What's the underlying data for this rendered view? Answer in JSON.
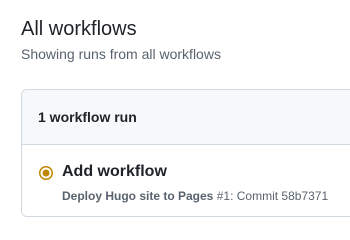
{
  "header": {
    "title": "All workflows",
    "subtitle": "Showing runs from all workflows"
  },
  "runs": {
    "count_label": "1 workflow run",
    "items": [
      {
        "title": "Add workflow",
        "status": "in-progress",
        "status_icon": "in-progress-dot-icon",
        "status_color": "#bf8700",
        "workflow_name": "Deploy Hugo site to Pages",
        "run_number": "#1",
        "event_text": ": Commit 58b7371"
      }
    ]
  }
}
